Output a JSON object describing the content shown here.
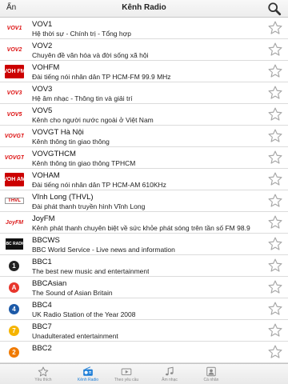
{
  "navbar": {
    "hide_label": "Ẩn",
    "title": "Kênh Radio"
  },
  "stations": [
    {
      "name": "VOV1",
      "description": "Hệ thời sự - Chính trị - Tổng hợp",
      "logo": "VOV1",
      "logo_style": "vov",
      "icon": "vov1-logo-icon"
    },
    {
      "name": "VOV2",
      "description": "Chuyên đề văn hóa và đời sống xã hội",
      "logo": "VOV2",
      "logo_style": "vov",
      "icon": "vov2-logo-icon"
    },
    {
      "name": "VOHFM",
      "description": "Đài tiếng nói nhân dân TP HCM-FM 99.9 MHz",
      "logo": "VOH FM",
      "logo_style": "fm",
      "icon": "vohfm-logo-icon"
    },
    {
      "name": "VOV3",
      "description": "Hệ âm nhạc - Thông tin và giải trí",
      "logo": "VOV3",
      "logo_style": "vov",
      "icon": "vov3-logo-icon"
    },
    {
      "name": "VOV5",
      "description": "Kênh cho người nước ngoài ở Việt Nam",
      "logo": "VOV5",
      "logo_style": "vov",
      "icon": "vov5-logo-icon"
    },
    {
      "name": "VOVGT Hà Nội",
      "description": "Kênh thông tin giao thông",
      "logo": "VOVGT",
      "logo_style": "vov",
      "icon": "vovgt-logo-icon"
    },
    {
      "name": "VOVGTHCM",
      "description": "Kênh thông tin giao thông TPHCM",
      "logo": "VOVGT",
      "logo_style": "vov",
      "icon": "vovgthcm-logo-icon"
    },
    {
      "name": "VOHAM",
      "description": "Đài tiếng nói nhân dân TP HCM-AM 610KHz",
      "logo": "VOH AM",
      "logo_style": "fm",
      "icon": "voham-logo-icon"
    },
    {
      "name": "Vĩnh Long (THVL)",
      "description": "Đài phát thanh truyền hình Vĩnh Long",
      "logo": "THVL",
      "logo_style": "thvl",
      "icon": "thvl-logo-icon"
    },
    {
      "name": "JoyFM",
      "description": "Kênh phát thanh chuyên biệt về sức khỏe phát sóng trên tần số FM 98.9",
      "logo": "JoyFM",
      "logo_style": "joy",
      "icon": "joyfm-logo-icon"
    },
    {
      "name": "BBCWS",
      "description": "BBC World Service - Live news and information",
      "logo": "BBC RADIO",
      "logo_style": "bbc",
      "icon": "bbc-radio-logo-icon"
    },
    {
      "name": "BBC1",
      "description": "The best new music and entertainment",
      "logo": "1",
      "logo_style": "circle",
      "color": "#222222",
      "icon": "bbc1-logo-icon"
    },
    {
      "name": "BBCAsian",
      "description": "The Sound of Asian Britain",
      "logo": "A",
      "logo_style": "circle",
      "color": "#e8362c",
      "icon": "bbc-asian-logo-icon"
    },
    {
      "name": "BBC4",
      "description": "UK Radio Station of the Year 2008",
      "logo": "4",
      "logo_style": "circle",
      "color": "#1d5aa8",
      "icon": "bbc4-logo-icon"
    },
    {
      "name": "BBC7",
      "description": "Unadulterated entertainment",
      "logo": "7",
      "logo_style": "circle",
      "color": "#f5b400",
      "icon": "bbc7-logo-icon"
    },
    {
      "name": "BBC2",
      "description": "",
      "logo": "2",
      "logo_style": "circle",
      "color": "#f07a00",
      "icon": "bbc2-logo-icon"
    }
  ],
  "tabs": [
    {
      "label": "Yêu thích",
      "icon": "star-icon",
      "active": false
    },
    {
      "label": "Kênh Radio",
      "icon": "radio-icon",
      "active": true
    },
    {
      "label": "Theo yêu cầu",
      "icon": "play-icon",
      "active": false
    },
    {
      "label": "Âm nhạc",
      "icon": "music-note-icon",
      "active": false
    },
    {
      "label": "Cá nhân",
      "icon": "person-icon",
      "active": false
    }
  ],
  "colors": {
    "accent": "#1f7fd8",
    "star_outline": "#a8a8a8",
    "vov_red": "#dd1111"
  }
}
